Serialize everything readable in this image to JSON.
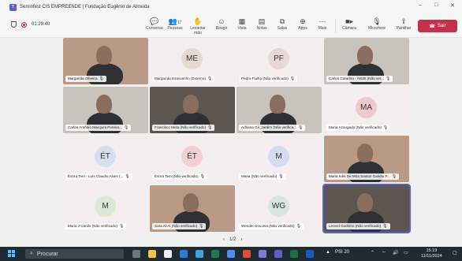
{
  "window": {
    "title": "Seminfest CIS EMPREENDE | Fundação Eugênio de Almeida"
  },
  "meeting": {
    "timer": "01:29:40"
  },
  "toolbar": {
    "chat": "Conversa",
    "people": "Pessoas",
    "people_count": "17",
    "raise": "Levantar mão",
    "react": "Reagir",
    "view": "Vista",
    "notes": "Notas",
    "rooms": "Salas",
    "apps": "Apps",
    "more": "Mais",
    "camera": "Câmara",
    "mic": "Microfone",
    "share": "Partilhar",
    "leave": "Sair"
  },
  "tiles": [
    {
      "name": "Margarida Oliveira",
      "initials": "",
      "kind": "video"
    },
    {
      "name": "Margarida Estevainho (Externo)",
      "initials": "ME",
      "kind": "avatar",
      "color": "#e6d9cf"
    },
    {
      "name": "Pedro Fialho (Não verificado)",
      "initials": "PF",
      "kind": "avatar",
      "color": "#ead8d6"
    },
    {
      "name": "Carlos Catarino - ANJE (Não ver...",
      "initials": "",
      "kind": "video"
    },
    {
      "name": "Carlos António Marques Pereira...",
      "initials": "",
      "kind": "video"
    },
    {
      "name": "Francisco Mota (Não verificado)",
      "initials": "",
      "kind": "video"
    },
    {
      "name": "Adriana Gil_Jardim (Não verifica...",
      "initials": "",
      "kind": "video"
    },
    {
      "name": "Maria Azougado (Não verificado)",
      "initials": "MA",
      "kind": "avatar",
      "color": "#f0c9cd"
    },
    {
      "name": "Évora Tem - Luís Claudio Alves (...",
      "initials": "ÉT",
      "kind": "avatar",
      "color": "#d5dff0"
    },
    {
      "name": "Évora Tem (Não verificado)",
      "initials": "ÉT",
      "kind": "avatar",
      "color": "#f3d0d0"
    },
    {
      "name": "Maria (Não verificado)",
      "initials": "M",
      "kind": "avatar",
      "color": "#d5dbf0"
    },
    {
      "name": "Maria Inês De Mira Santos Galvão P...",
      "initials": "",
      "kind": "video"
    },
    {
      "name": "Maria J Canilo (Não verificado)",
      "initials": "M",
      "kind": "avatar",
      "color": "#dbe8d5"
    },
    {
      "name": "Sara Al-Ai (Não verificado)",
      "initials": "",
      "kind": "video"
    },
    {
      "name": "Wendel Gouveia (Não verificado)",
      "initials": "WG",
      "kind": "avatar",
      "color": "#d5e6e0"
    },
    {
      "name": "Leonel Godinho (Não verificado)",
      "initials": "",
      "kind": "video"
    }
  ],
  "pager": {
    "label": "1/2"
  },
  "taskbar": {
    "search": "Procurar",
    "tray_label": "PSI 20",
    "time": "15:19",
    "date": "11/11/2024"
  }
}
